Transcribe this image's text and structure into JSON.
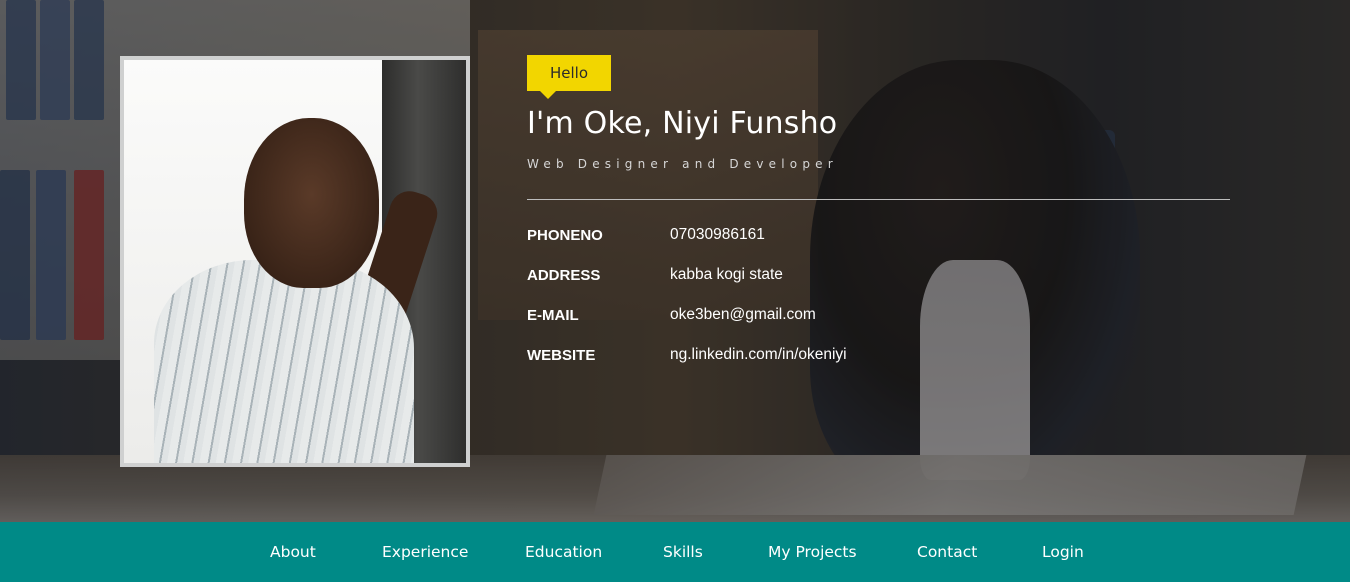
{
  "profile": {
    "greeting": "Hello",
    "name": "I'm Oke, Niyi Funsho",
    "tagline": "Web Designer and Developer",
    "photo_icon": "profile-photo"
  },
  "details": [
    {
      "label": "PHONENO",
      "value": "07030986161"
    },
    {
      "label": "ADDRESS",
      "value": "kabba kogi state"
    },
    {
      "label": "E-MAIL",
      "value": "oke3ben@gmail.com"
    },
    {
      "label": "WEBSITE",
      "value": "ng.linkedin.com/in/okeniyi"
    }
  ],
  "nav": {
    "items": [
      {
        "label": "About"
      },
      {
        "label": "Experience"
      },
      {
        "label": "Education"
      },
      {
        "label": "Skills"
      },
      {
        "label": "My Projects"
      },
      {
        "label": "Contact"
      },
      {
        "label": "Login"
      }
    ]
  },
  "colors": {
    "nav_background": "#008a87",
    "badge": "#f2d600",
    "text": "#ffffff"
  }
}
